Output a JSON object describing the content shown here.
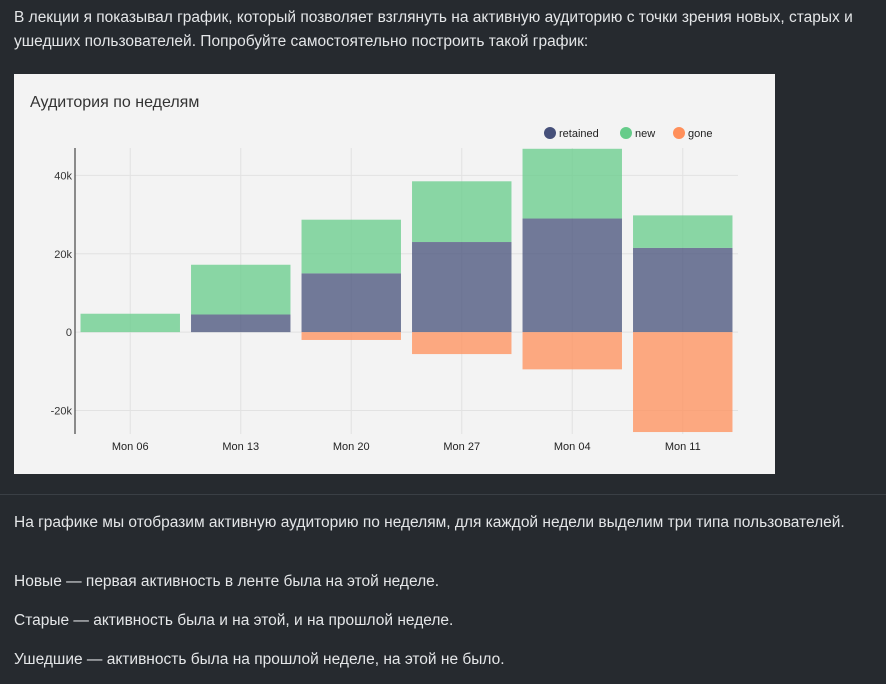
{
  "intro_text": "В лекции я показывал график, который позволяет взглянуть на активную аудиторию с точки зрения новых, старых и ушедших пользователей. Попробуйте самостоятельно построить такой график:",
  "paragraphs": [
    "На графике мы отобразим активную аудиторию по неделям, для каждой недели выделим три типа пользователей.",
    "Новые — первая активность в ленте была на этой неделе.",
    "Старые — активность была и на этой, и на прошлой неделе.",
    "Ушедшие — активность была на прошлой неделе, на этой не было."
  ],
  "chart_data": {
    "type": "bar",
    "stacked": true,
    "title": "Аудитория по неделям",
    "categories": [
      "Mon 06",
      "Mon 13",
      "Mon 20",
      "Mon 27",
      "Mon 04",
      "Mon 11"
    ],
    "series": [
      {
        "name": "retained",
        "color": "#46507a",
        "values": [
          0,
          4500,
          15000,
          23000,
          29000,
          21500
        ]
      },
      {
        "name": "new",
        "color": "#66cc8a",
        "values": [
          4700,
          12700,
          13700,
          15500,
          17800,
          8300
        ]
      },
      {
        "name": "gone",
        "color": "#ff8f5a",
        "values": [
          0,
          0,
          -2000,
          -5600,
          -9500,
          -25500
        ]
      }
    ],
    "ylim": [
      -26000,
      47000
    ],
    "yticks": [
      -20000,
      0,
      20000,
      40000
    ],
    "ytick_labels": [
      "-20k",
      "0",
      "20k",
      "40k"
    ],
    "legend_position": "top-right",
    "grid": true
  }
}
